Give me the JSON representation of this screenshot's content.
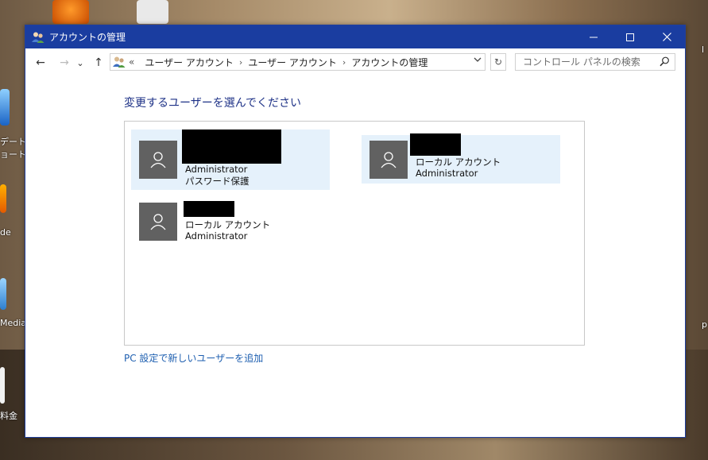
{
  "desktop": {
    "labels": [
      "デートを",
      "ョート...",
      "de",
      "Media",
      "料金"
    ],
    "right_labels": [
      "l",
      "p"
    ]
  },
  "window": {
    "title": "アカウントの管理",
    "controls": {
      "minimize": "—",
      "maximize": "☐",
      "close": "✕"
    }
  },
  "navigation": {
    "back": "←",
    "forward": "→",
    "recent": "⌄",
    "up": "↑",
    "overflow": "«",
    "breadcrumbs": [
      "ユーザー アカウント",
      "ユーザー アカウント",
      "アカウントの管理"
    ],
    "separator": "›",
    "refresh": "↻"
  },
  "search": {
    "placeholder": "コントロール パネルの検索"
  },
  "main": {
    "heading": "変更するユーザーを選んでください",
    "accounts": [
      {
        "line1": "Administrator",
        "line2": "パスワード保護",
        "selected": true
      },
      {
        "line1": "ローカル アカウント",
        "line2": "Administrator",
        "selected": true
      },
      {
        "line1": "ローカル アカウント",
        "line2": "Administrator",
        "selected": false
      }
    ],
    "add_user_link": "PC 設定で新しいユーザーを追加"
  }
}
